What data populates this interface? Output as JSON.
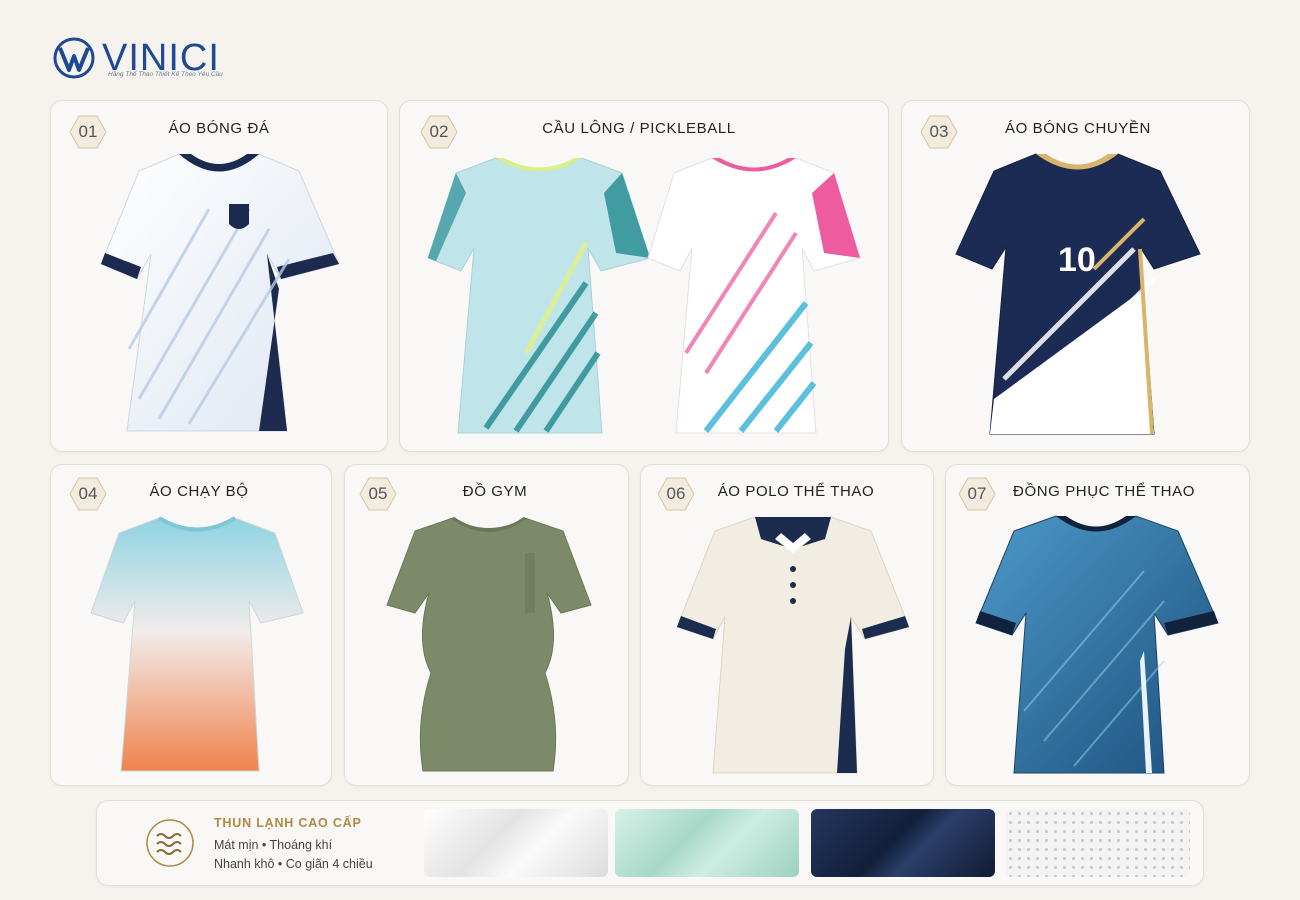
{
  "brand": {
    "name": "VINICI",
    "tagline": "Hãng Thể Thao Thiết Kế Theo Yêu Cầu",
    "colors": {
      "primary": "#1d4a92",
      "accent": "#b08a45"
    }
  },
  "categories": [
    {
      "number": "01",
      "title": "ÁO BÓNG ĐÁ",
      "icon": "football-jersey-icon"
    },
    {
      "number": "02",
      "title": "CẦU LÔNG / PICKLEBALL",
      "icon": "badminton-shirt-icon"
    },
    {
      "number": "03",
      "title": "ÁO BÓNG CHUYỀN",
      "icon": "volleyball-jersey-icon"
    },
    {
      "number": "04",
      "title": "ÁO CHẠY BỘ",
      "icon": "running-shirt-icon"
    },
    {
      "number": "05",
      "title": "ĐỒ GYM",
      "icon": "gym-shirt-icon"
    },
    {
      "number": "06",
      "title": "ÁO POLO THỂ THAO",
      "icon": "polo-shirt-icon"
    },
    {
      "number": "07",
      "title": "ĐỒNG PHỤC THỂ THAO",
      "icon": "team-uniform-icon"
    }
  ],
  "jersey_number": "10",
  "fabric": {
    "title": "THUN LẠNH CAO CẤP",
    "line1": "Mát mịn • Thoáng khí",
    "line2": "Nhanh khô • Co giãn 4 chiều",
    "swatches": [
      {
        "name": "white",
        "color": "#f2f2f2"
      },
      {
        "name": "mint",
        "color": "#bfe6da"
      },
      {
        "name": "navy",
        "color": "#1b2c4e"
      },
      {
        "name": "mesh-white",
        "color": "#f0f0f0"
      }
    ]
  }
}
